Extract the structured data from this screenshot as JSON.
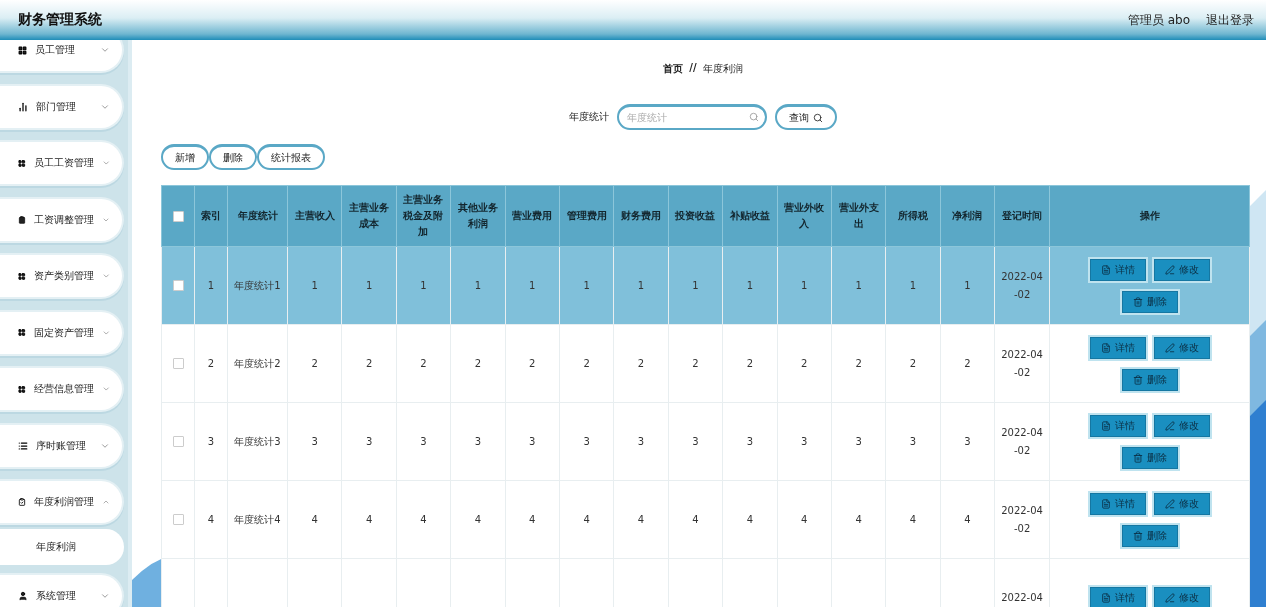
{
  "header": {
    "title": "财务管理系统",
    "user": "管理员 abo",
    "logout": "退出登录"
  },
  "sidebar": {
    "items": [
      {
        "label": "员工管理",
        "kind": "grid",
        "expanded": false
      },
      {
        "label": "部门管理",
        "kind": "chart",
        "expanded": false
      },
      {
        "label": "员工工资管理",
        "kind": "grid",
        "expanded": false
      },
      {
        "label": "工资调整管理",
        "kind": "clipboard",
        "expanded": false
      },
      {
        "label": "资产类别管理",
        "kind": "grid",
        "expanded": false
      },
      {
        "label": "固定资产管理",
        "kind": "grid",
        "expanded": false
      },
      {
        "label": "经营信息管理",
        "kind": "grid",
        "expanded": false
      },
      {
        "label": "序时账管理",
        "kind": "list",
        "expanded": false
      },
      {
        "label": "年度利润管理",
        "kind": "check",
        "expanded": true,
        "children": [
          {
            "label": "年度利润",
            "selected": true
          }
        ]
      },
      {
        "label": "系统管理",
        "kind": "user",
        "expanded": false
      }
    ]
  },
  "breadcrumb": {
    "home": "首页",
    "separator": "//",
    "current": "年度利润"
  },
  "search": {
    "label": "年度统计",
    "placeholder": "年度统计",
    "button": "查询"
  },
  "toolbar": [
    "新增",
    "删除",
    "统计报表"
  ],
  "table": {
    "all_checked": false,
    "columns": [
      "索引",
      "年度统计",
      "主营收入",
      "主营业务成本",
      "主营业务税金及附加",
      "其他业务利润",
      "营业费用",
      "管理费用",
      "财务费用",
      "投资收益",
      "补贴收益",
      "营业外收入",
      "营业外支出",
      "所得税",
      "净利润",
      "登记时间",
      "操作"
    ],
    "rows": [
      {
        "selected": true,
        "checked": false,
        "cells": [
          "1",
          "年度统计1",
          "1",
          "1",
          "1",
          "1",
          "1",
          "1",
          "1",
          "1",
          "1",
          "1",
          "1",
          "1",
          "1",
          "2022-04-02"
        ],
        "actions": [
          "详情",
          "修改",
          "删除"
        ]
      },
      {
        "selected": false,
        "checked": false,
        "cells": [
          "2",
          "年度统计2",
          "2",
          "2",
          "2",
          "2",
          "2",
          "2",
          "2",
          "2",
          "2",
          "2",
          "2",
          "2",
          "2",
          "2022-04-02"
        ],
        "actions": [
          "详情",
          "修改",
          "删除"
        ]
      },
      {
        "selected": false,
        "checked": false,
        "cells": [
          "3",
          "年度统计3",
          "3",
          "3",
          "3",
          "3",
          "3",
          "3",
          "3",
          "3",
          "3",
          "3",
          "3",
          "3",
          "3",
          "2022-04-02"
        ],
        "actions": [
          "详情",
          "修改",
          "删除"
        ]
      },
      {
        "selected": false,
        "checked": false,
        "cells": [
          "4",
          "年度统计4",
          "4",
          "4",
          "4",
          "4",
          "4",
          "4",
          "4",
          "4",
          "4",
          "4",
          "4",
          "4",
          "4",
          "2022-04-02"
        ],
        "actions": [
          "详情",
          "修改",
          "删除"
        ]
      },
      {
        "selected": false,
        "cells": [
          "",
          "",
          "",
          "",
          "",
          "",
          "",
          "",
          "",
          "",
          "",
          "",
          "",
          "",
          "",
          "2022-04"
        ],
        "actions": [
          "详情",
          "修改"
        ]
      }
    ]
  }
}
